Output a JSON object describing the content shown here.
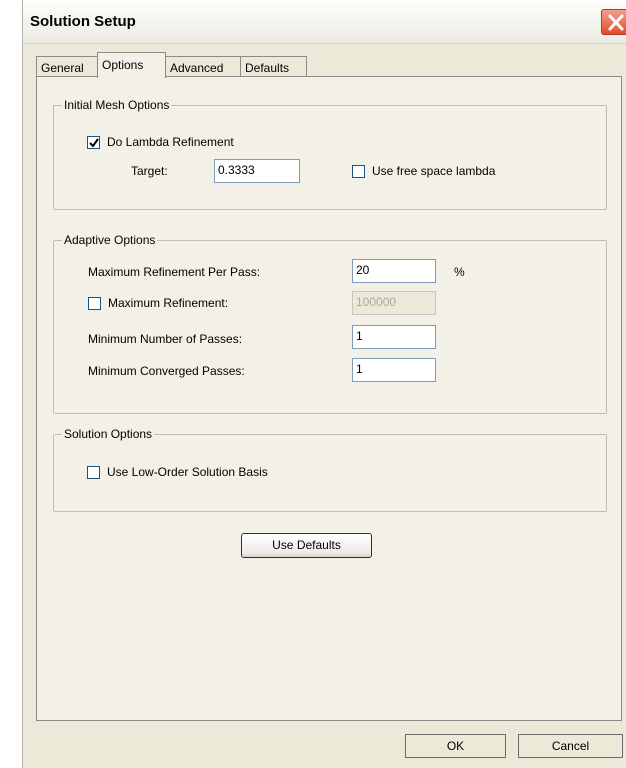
{
  "window": {
    "title": "Solution Setup"
  },
  "tabs": [
    {
      "label": "General"
    },
    {
      "label": "Options"
    },
    {
      "label": "Advanced"
    },
    {
      "label": "Defaults"
    }
  ],
  "active_tab": "Options",
  "initial_mesh": {
    "group_label": "Initial Mesh Options",
    "lambda_refinement": {
      "label": "Do Lambda Refinement",
      "checked": true
    },
    "target": {
      "label": "Target:",
      "value": "0.3333"
    },
    "free_space": {
      "label": "Use free space lambda",
      "checked": false
    }
  },
  "adaptive": {
    "group_label": "Adaptive Options",
    "max_refinement_per_pass": {
      "label": "Maximum Refinement Per Pass:",
      "value": "20",
      "unit": "%"
    },
    "max_refinement": {
      "label": "Maximum Refinement:",
      "value": "100000",
      "checked": false
    },
    "min_passes": {
      "label": "Minimum Number of Passes:",
      "value": "1"
    },
    "min_converged": {
      "label": "Minimum Converged Passes:",
      "value": "1"
    }
  },
  "solution": {
    "group_label": "Solution Options",
    "low_order": {
      "label": "Use Low-Order Solution Basis",
      "checked": false
    }
  },
  "use_defaults_label": "Use Defaults",
  "footer": {
    "ok_label": "OK",
    "cancel_label": "Cancel"
  }
}
